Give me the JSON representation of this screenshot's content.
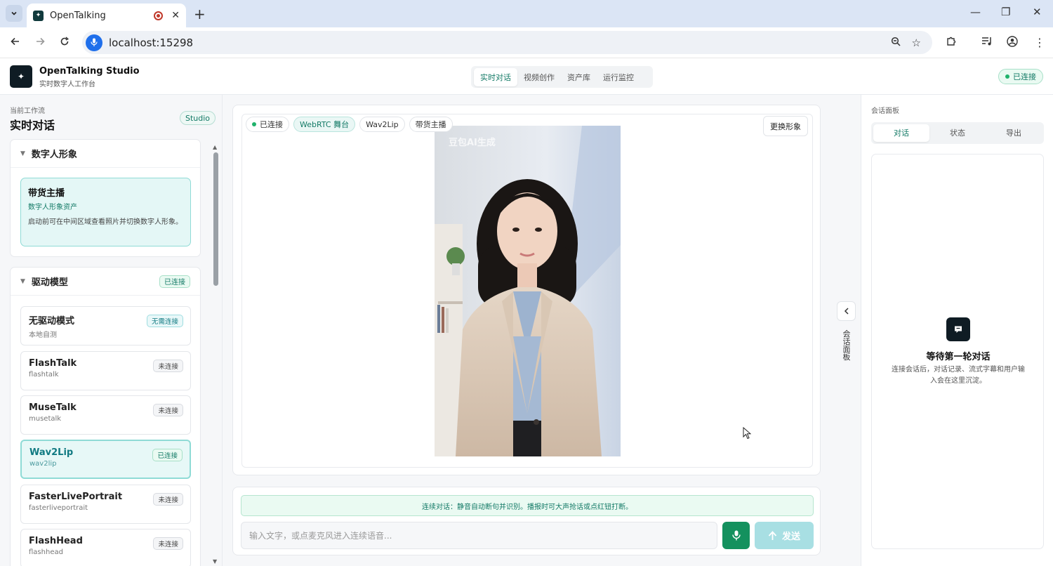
{
  "browser": {
    "tab_title": "OpenTalking",
    "new_tab": "+",
    "url": "localhost:15298",
    "window_controls": {
      "minimize": "—",
      "restore": "❐",
      "close": "✕"
    }
  },
  "header": {
    "brand_title": "OpenTalking Studio",
    "brand_subtitle": "实时数字人工作台",
    "nav_tabs": [
      {
        "label": "实时对话",
        "active": true
      },
      {
        "label": "视频创作",
        "active": false
      },
      {
        "label": "资产库",
        "active": false
      },
      {
        "label": "运行监控",
        "active": false
      }
    ],
    "status": "已连接"
  },
  "left": {
    "workflow_label": "当前工作流",
    "workflow_title": "实时对话",
    "studio_badge": "Studio",
    "avatar_panel": {
      "title": "数字人形象",
      "card": {
        "title": "带货主播",
        "subtitle": "数字人形象资产",
        "description": "启动前可在中间区域查看照片并切换数字人形象。"
      }
    },
    "model_panel": {
      "title": "驱动模型",
      "status": "已连接",
      "models": [
        {
          "name": "无驱动模式",
          "id": "本地自测",
          "badge": "无需连接",
          "state": "none",
          "selected": false
        },
        {
          "name": "FlashTalk",
          "id": "flashtalk",
          "badge": "未连接",
          "state": "off",
          "selected": false
        },
        {
          "name": "MuseTalk",
          "id": "musetalk",
          "badge": "未连接",
          "state": "off",
          "selected": false
        },
        {
          "name": "Wav2Lip",
          "id": "wav2lip",
          "badge": "已连接",
          "state": "ok",
          "selected": true
        },
        {
          "name": "FasterLivePortrait",
          "id": "fasterliveportrait",
          "badge": "未连接",
          "state": "off",
          "selected": false
        },
        {
          "name": "FlashHead",
          "id": "flashhead",
          "badge": "未连接",
          "state": "off",
          "selected": false
        }
      ]
    }
  },
  "stage": {
    "chips": [
      "已连接",
      "WebRTC 舞台",
      "Wav2Lip",
      "带货主播"
    ],
    "swap_button": "更换形象",
    "watermark": "豆包AI生成"
  },
  "composer": {
    "hint": "连续对话：静音自动断句并识别。播报时可大声抢话或点红钮打断。",
    "placeholder": "输入文字，或点麦克风进入连续语音...",
    "value": "",
    "send_label": "发送"
  },
  "side_toggle": {
    "label": "会话面板"
  },
  "right": {
    "panel_label": "会话面板",
    "tabs": [
      {
        "label": "对话",
        "active": true
      },
      {
        "label": "状态",
        "active": false
      },
      {
        "label": "导出",
        "active": false
      }
    ],
    "empty_title": "等待第一轮对话",
    "empty_desc": "连接会话后，对话记录、流式字幕和用户输入会在这里沉淀。"
  },
  "colors": {
    "accent": "#137a66",
    "mic": "#14915e",
    "send": "#a8dfe3"
  }
}
